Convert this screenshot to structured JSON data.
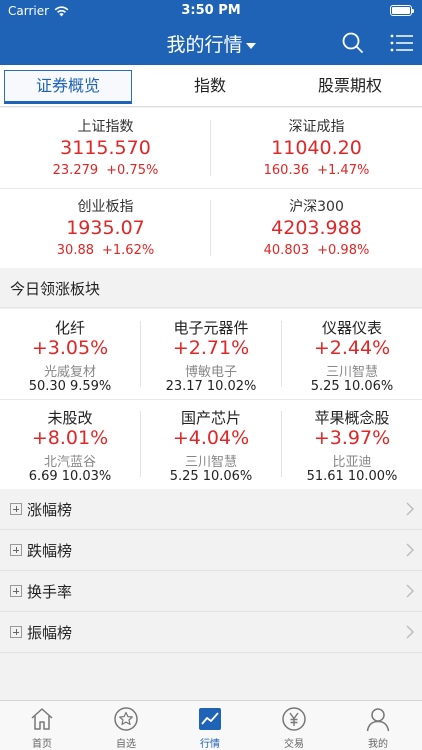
{
  "status_bar": {
    "carrier": "Carrier",
    "time": "3:50 PM"
  },
  "header": {
    "title": "我的行情"
  },
  "tabs": [
    {
      "label": "证券概览",
      "active": true
    },
    {
      "label": "指数",
      "active": false
    },
    {
      "label": "股票期权",
      "active": false
    }
  ],
  "indices": [
    {
      "name": "上证指数",
      "value": "3115.570",
      "change": "23.279",
      "percent": "+0.75%"
    },
    {
      "name": "深证成指",
      "value": "11040.20",
      "change": "160.36",
      "percent": "+1.47%"
    },
    {
      "name": "创业板指",
      "value": "1935.07",
      "change": "30.88",
      "percent": "+1.62%"
    },
    {
      "name": "沪深300",
      "value": "4203.988",
      "change": "40.803",
      "percent": "+0.98%"
    }
  ],
  "sectors_section": {
    "title": "今日领涨板块"
  },
  "sectors": [
    {
      "name": "化纤",
      "percent": "+3.05%",
      "stock": "光威复材",
      "price": "50.30",
      "stock_pct": "9.59%"
    },
    {
      "name": "电子元器件",
      "percent": "+2.71%",
      "stock": "博敏电子",
      "price": "23.17",
      "stock_pct": "10.02%"
    },
    {
      "name": "仪器仪表",
      "percent": "+2.44%",
      "stock": "三川智慧",
      "price": "5.25",
      "stock_pct": "10.06%"
    },
    {
      "name": "未股改",
      "percent": "+8.01%",
      "stock": "北汽蓝谷",
      "price": "6.69",
      "stock_pct": "10.03%"
    },
    {
      "name": "国产芯片",
      "percent": "+4.04%",
      "stock": "三川智慧",
      "price": "5.25",
      "stock_pct": "10.06%"
    },
    {
      "name": "苹果概念股",
      "percent": "+3.97%",
      "stock": "比亚迪",
      "price": "51.61",
      "stock_pct": "10.00%"
    }
  ],
  "rankings": [
    {
      "label": "涨幅榜"
    },
    {
      "label": "跌幅榜"
    },
    {
      "label": "换手率"
    },
    {
      "label": "振幅榜"
    }
  ],
  "bottom_nav": [
    {
      "label": "首页",
      "icon": "home-icon"
    },
    {
      "label": "自选",
      "icon": "star-icon"
    },
    {
      "label": "行情",
      "icon": "chart-icon",
      "active": true
    },
    {
      "label": "交易",
      "icon": "yen-icon"
    },
    {
      "label": "我的",
      "icon": "user-icon"
    }
  ],
  "colors": {
    "brand": "#1e63b5",
    "up": "#e02626"
  }
}
